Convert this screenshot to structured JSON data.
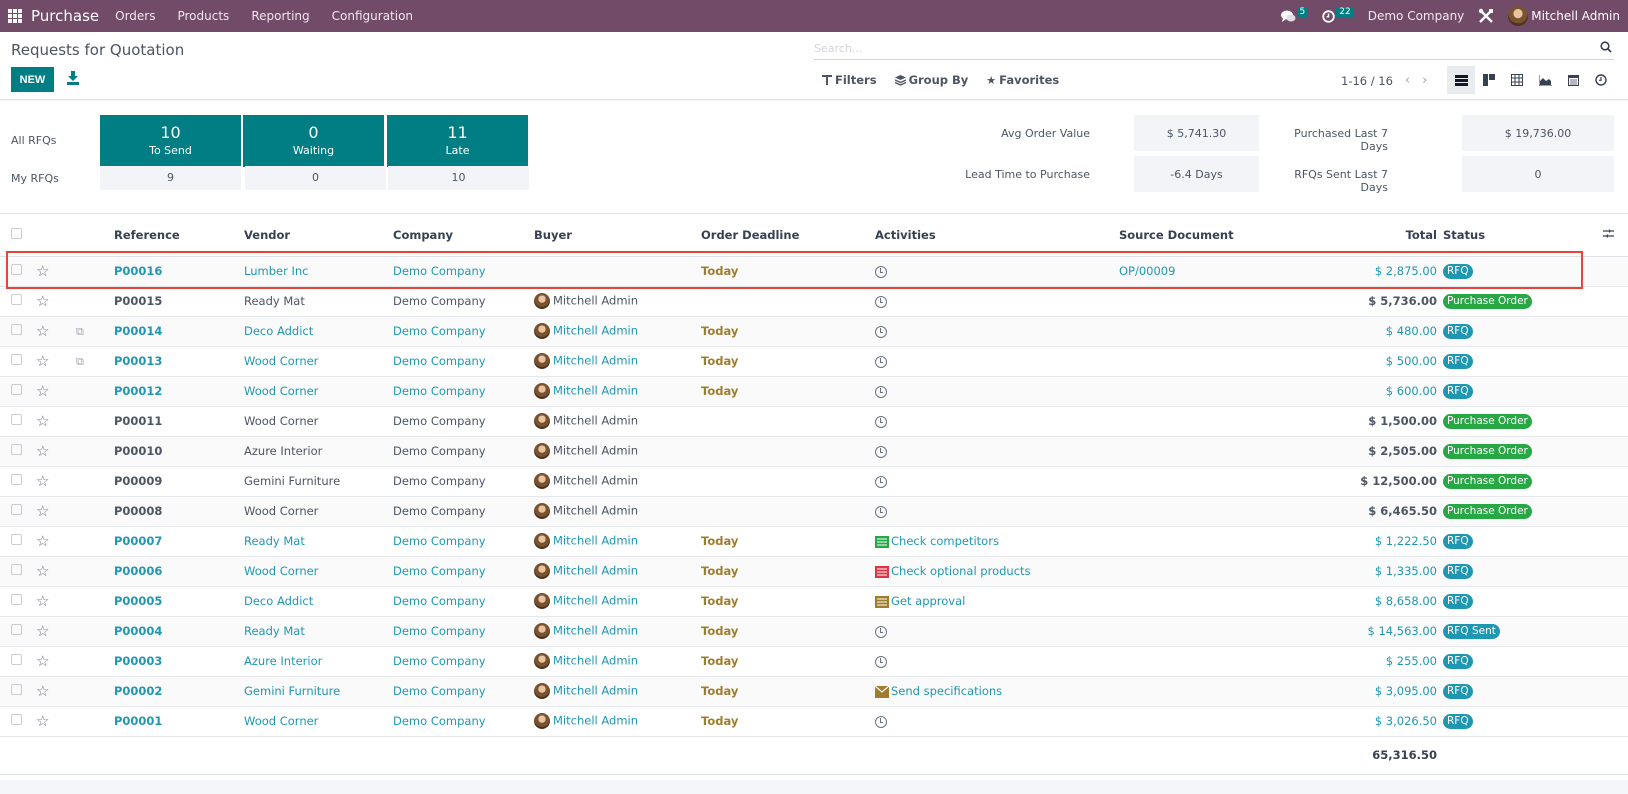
{
  "navbar": {
    "app_name": "Purchase",
    "menus": [
      "Orders",
      "Products",
      "Reporting",
      "Configuration"
    ],
    "messages_count": "5",
    "activities_count": "22",
    "company": "Demo Company",
    "user": "Mitchell Admin",
    "brand_color": "#714b67"
  },
  "control": {
    "title": "Requests for Quotation",
    "new_label": "NEW",
    "search_placeholder": "Search...",
    "filters_label": "Filters",
    "groupby_label": "Group By",
    "favorites_label": "Favorites",
    "pager": "1-16 / 16",
    "views": [
      "list-view",
      "kanban-view",
      "pivot-view",
      "graph-view",
      "calendar-view",
      "activity-view"
    ],
    "active_view": "list-view"
  },
  "dashboard": {
    "all_rfqs_label": "All RFQs",
    "my_rfqs_label": "My RFQs",
    "tiles": [
      {
        "count": "10",
        "label": "To Send",
        "mine": "9"
      },
      {
        "count": "0",
        "label": "Waiting",
        "mine": "0"
      },
      {
        "count": "11",
        "label": "Late",
        "mine": "10"
      }
    ],
    "kpis": [
      {
        "label": "Avg Order Value",
        "value": "$ 5,741.30"
      },
      {
        "label": "Purchased Last 7 Days",
        "value": "$ 19,736.00"
      },
      {
        "label": "Lead Time to Purchase",
        "value": "-6.4 Days"
      },
      {
        "label": "RFQs Sent Last 7 Days",
        "value": "0"
      }
    ],
    "accent_color": "#017e84"
  },
  "table": {
    "columns": [
      "Reference",
      "Vendor",
      "Company",
      "Buyer",
      "Order Deadline",
      "Activities",
      "Source Document",
      "Total",
      "Status"
    ],
    "rows": [
      {
        "ref": "P00016",
        "vendor": "Lumber Inc",
        "company": "Demo Company",
        "buyer": "",
        "deadline": "Today",
        "activity": "",
        "activity_type": "clock",
        "source": "OP/00009",
        "total": "$ 2,875.00",
        "status": "RFQ",
        "status_kind": "rfq",
        "is_link": true,
        "dup": false
      },
      {
        "ref": "P00015",
        "vendor": "Ready Mat",
        "company": "Demo Company",
        "buyer": "Mitchell Admin",
        "deadline": "",
        "activity": "",
        "activity_type": "clock",
        "source": "",
        "total": "$ 5,736.00",
        "status": "Purchase Order",
        "status_kind": "po",
        "is_link": false,
        "dup": false
      },
      {
        "ref": "P00014",
        "vendor": "Deco Addict",
        "company": "Demo Company",
        "buyer": "Mitchell Admin",
        "deadline": "Today",
        "activity": "",
        "activity_type": "clock",
        "source": "",
        "total": "$ 480.00",
        "status": "RFQ",
        "status_kind": "rfq",
        "is_link": true,
        "dup": true
      },
      {
        "ref": "P00013",
        "vendor": "Wood Corner",
        "company": "Demo Company",
        "buyer": "Mitchell Admin",
        "deadline": "Today",
        "activity": "",
        "activity_type": "clock",
        "source": "",
        "total": "$ 500.00",
        "status": "RFQ",
        "status_kind": "rfq",
        "is_link": true,
        "dup": true
      },
      {
        "ref": "P00012",
        "vendor": "Wood Corner",
        "company": "Demo Company",
        "buyer": "Mitchell Admin",
        "deadline": "Today",
        "activity": "",
        "activity_type": "clock",
        "source": "",
        "total": "$ 600.00",
        "status": "RFQ",
        "status_kind": "rfq",
        "is_link": true,
        "dup": false
      },
      {
        "ref": "P00011",
        "vendor": "Wood Corner",
        "company": "Demo Company",
        "buyer": "Mitchell Admin",
        "deadline": "",
        "activity": "",
        "activity_type": "clock",
        "source": "",
        "total": "$ 1,500.00",
        "status": "Purchase Order",
        "status_kind": "po",
        "is_link": false,
        "dup": false
      },
      {
        "ref": "P00010",
        "vendor": "Azure Interior",
        "company": "Demo Company",
        "buyer": "Mitchell Admin",
        "deadline": "",
        "activity": "",
        "activity_type": "clock",
        "source": "",
        "total": "$ 2,505.00",
        "status": "Purchase Order",
        "status_kind": "po",
        "is_link": false,
        "dup": false
      },
      {
        "ref": "P00009",
        "vendor": "Gemini Furniture",
        "company": "Demo Company",
        "buyer": "Mitchell Admin",
        "deadline": "",
        "activity": "",
        "activity_type": "clock",
        "source": "",
        "total": "$ 12,500.00",
        "status": "Purchase Order",
        "status_kind": "po",
        "is_link": false,
        "dup": false
      },
      {
        "ref": "P00008",
        "vendor": "Wood Corner",
        "company": "Demo Company",
        "buyer": "Mitchell Admin",
        "deadline": "",
        "activity": "",
        "activity_type": "clock",
        "source": "",
        "total": "$ 6,465.50",
        "status": "Purchase Order",
        "status_kind": "po",
        "is_link": false,
        "dup": false
      },
      {
        "ref": "P00007",
        "vendor": "Ready Mat",
        "company": "Demo Company",
        "buyer": "Mitchell Admin",
        "deadline": "Today",
        "activity": "Check competitors",
        "activity_type": "todo-green",
        "source": "",
        "total": "$ 1,222.50",
        "status": "RFQ",
        "status_kind": "rfq",
        "is_link": true,
        "dup": false
      },
      {
        "ref": "P00006",
        "vendor": "Wood Corner",
        "company": "Demo Company",
        "buyer": "Mitchell Admin",
        "deadline": "Today",
        "activity": "Check optional products",
        "activity_type": "todo-red",
        "source": "",
        "total": "$ 1,335.00",
        "status": "RFQ",
        "status_kind": "rfq",
        "is_link": true,
        "dup": false
      },
      {
        "ref": "P00005",
        "vendor": "Deco Addict",
        "company": "Demo Company",
        "buyer": "Mitchell Admin",
        "deadline": "Today",
        "activity": "Get approval",
        "activity_type": "todo-brown",
        "source": "",
        "total": "$ 8,658.00",
        "status": "RFQ",
        "status_kind": "rfq",
        "is_link": true,
        "dup": false
      },
      {
        "ref": "P00004",
        "vendor": "Ready Mat",
        "company": "Demo Company",
        "buyer": "Mitchell Admin",
        "deadline": "Today",
        "activity": "",
        "activity_type": "clock",
        "source": "",
        "total": "$ 14,563.00",
        "status": "RFQ Sent",
        "status_kind": "sent",
        "is_link": true,
        "dup": false
      },
      {
        "ref": "P00003",
        "vendor": "Azure Interior",
        "company": "Demo Company",
        "buyer": "Mitchell Admin",
        "deadline": "Today",
        "activity": "",
        "activity_type": "clock",
        "source": "",
        "total": "$ 255.00",
        "status": "RFQ",
        "status_kind": "rfq",
        "is_link": true,
        "dup": false
      },
      {
        "ref": "P00002",
        "vendor": "Gemini Furniture",
        "company": "Demo Company",
        "buyer": "Mitchell Admin",
        "deadline": "Today",
        "activity": "Send specifications",
        "activity_type": "email",
        "source": "",
        "total": "$ 3,095.00",
        "status": "RFQ",
        "status_kind": "rfq",
        "is_link": true,
        "dup": false
      },
      {
        "ref": "P00001",
        "vendor": "Wood Corner",
        "company": "Demo Company",
        "buyer": "Mitchell Admin",
        "deadline": "Today",
        "activity": "",
        "activity_type": "clock",
        "source": "",
        "total": "$ 3,026.50",
        "status": "RFQ",
        "status_kind": "rfq",
        "is_link": true,
        "dup": false
      }
    ],
    "grand_total": "65,316.50",
    "highlighted_row": "P00016"
  }
}
